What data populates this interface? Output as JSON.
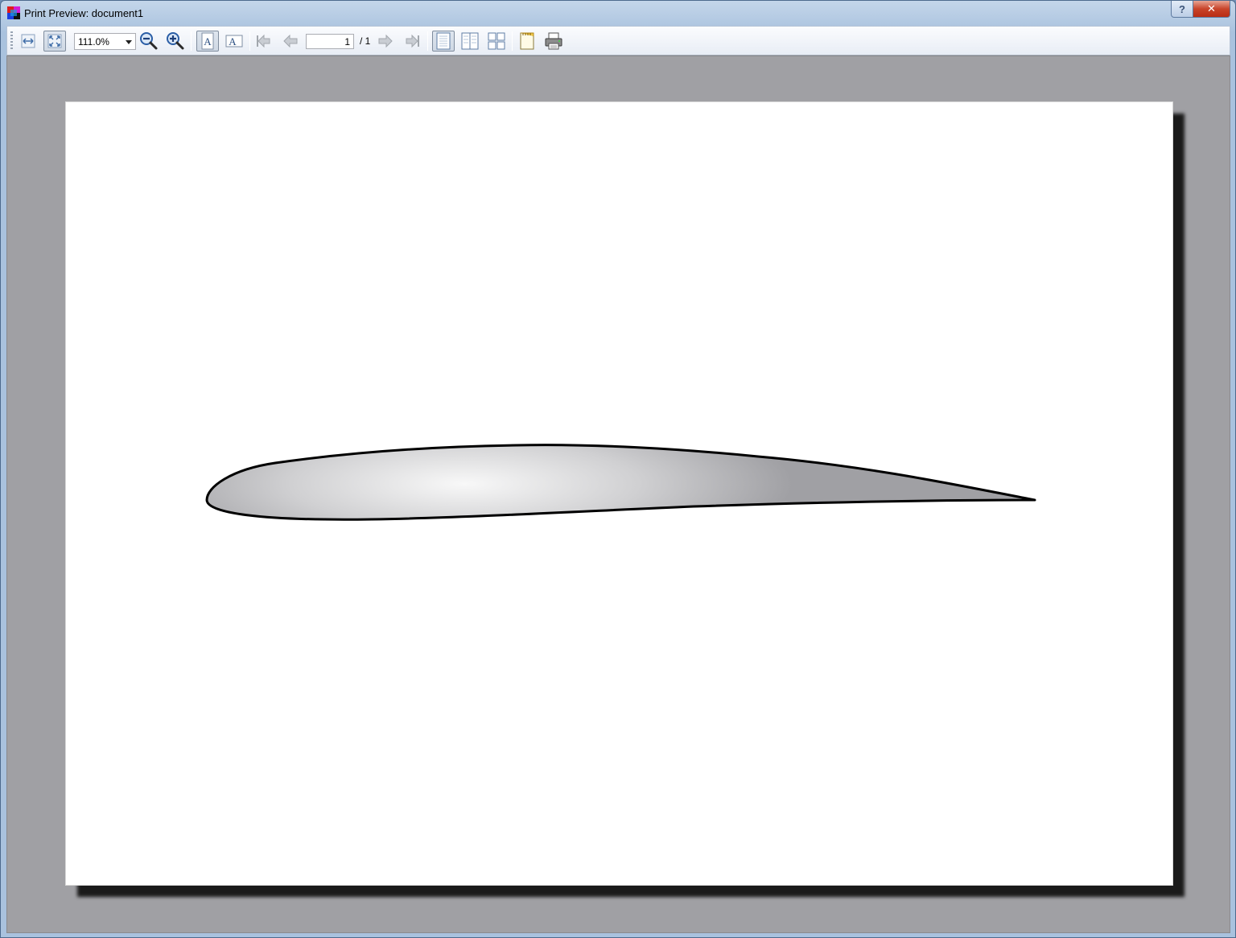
{
  "window": {
    "title": "Print Preview: document1",
    "help_label": "?",
    "close_label": "✕"
  },
  "toolbar": {
    "zoom_value": "111.0%",
    "current_page": "1",
    "page_total": "/ 1",
    "buttons": [
      "fit-width",
      "fit-page",
      "zoom-out",
      "zoom-in",
      "portrait",
      "landscape",
      "first-page",
      "previous-page",
      "next-page",
      "last-page",
      "single-page",
      "facing-pages",
      "overview",
      "page-setup",
      "print"
    ]
  },
  "colors": {
    "preview_background": "#a0a0a4",
    "page": "#ffffff",
    "airfoil_outline": "#000000",
    "airfoil_fill_light": "#f8f8f8",
    "airfoil_fill_dark": "#a0a0a4"
  }
}
